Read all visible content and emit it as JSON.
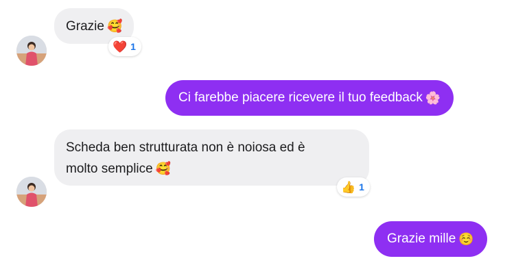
{
  "messages": [
    {
      "text": "Grazie",
      "emoji": "🥰",
      "direction": "incoming",
      "reaction": {
        "emoji": "❤️",
        "count": "1"
      }
    },
    {
      "text": "Ci farebbe piacere ricevere il tuo feedback",
      "emoji": "🌸",
      "direction": "outgoing"
    },
    {
      "line1": "Scheda ben strutturata non è noiosa ed è",
      "line2": "molto semplice",
      "emoji": "🥰",
      "direction": "incoming",
      "reaction": {
        "emoji": "👍",
        "count": "1"
      }
    },
    {
      "text": "Grazie mille",
      "emoji": "☺️",
      "direction": "outgoing"
    }
  ],
  "colors": {
    "outgoing_bubble": "#8e2ff2",
    "incoming_bubble": "#efeff1",
    "reaction_count": "#1a74e8"
  }
}
